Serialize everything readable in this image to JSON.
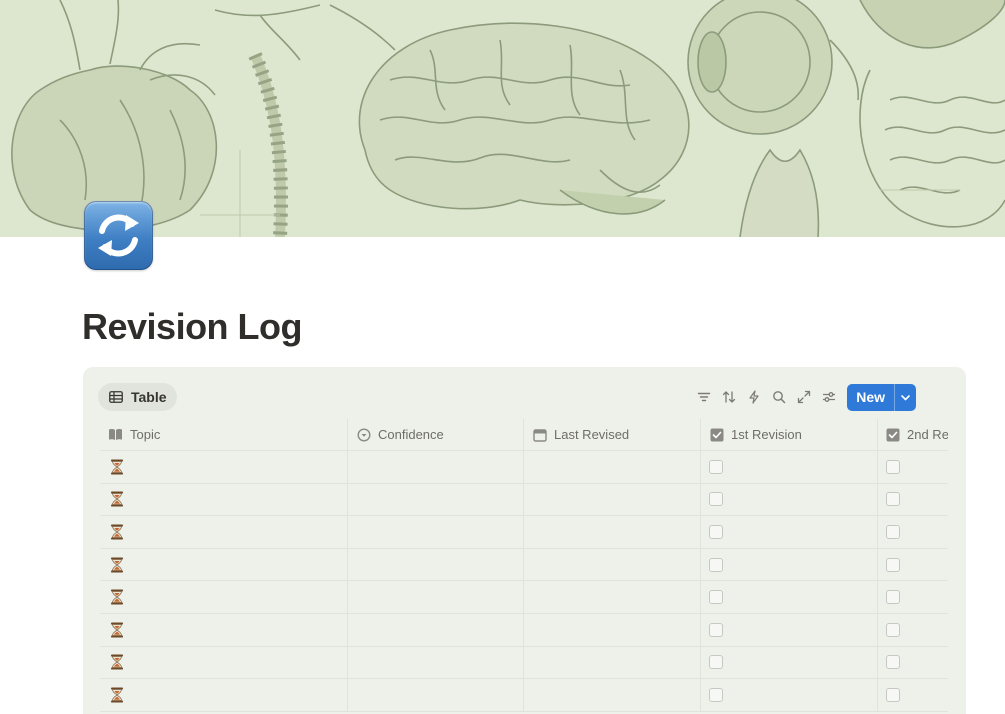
{
  "page": {
    "title": "Revision Log",
    "icon": "arrows-counterclockwise-emoji-icon"
  },
  "cover": {
    "description_icon": "anatomy-illustration-cover",
    "tint": "#dfe8d2"
  },
  "database": {
    "view_tab_label": "Table",
    "view_tab_icon": "table-icon",
    "toolbar": {
      "icons": [
        "filter-icon",
        "sort-icon",
        "automation-icon",
        "search-icon",
        "expand-icon",
        "settings-icon"
      ],
      "new_label": "New"
    },
    "columns": [
      {
        "label": "Topic",
        "icon": "book-icon"
      },
      {
        "label": "Confidence",
        "icon": "status-icon"
      },
      {
        "label": "Last Revised",
        "icon": "calendar-icon"
      },
      {
        "label": "1st Revision",
        "icon": "checkbox-icon"
      },
      {
        "label": "2nd Re",
        "icon": "checkbox-icon"
      }
    ],
    "rows": [
      {
        "topic_icon": "hourglass-icon",
        "confidence": "",
        "last_revised": "",
        "rev1": false,
        "rev2": false
      },
      {
        "topic_icon": "hourglass-icon",
        "confidence": "",
        "last_revised": "",
        "rev1": false,
        "rev2": false
      },
      {
        "topic_icon": "hourglass-icon",
        "confidence": "",
        "last_revised": "",
        "rev1": false,
        "rev2": false
      },
      {
        "topic_icon": "hourglass-icon",
        "confidence": "",
        "last_revised": "",
        "rev1": false,
        "rev2": false
      },
      {
        "topic_icon": "hourglass-icon",
        "confidence": "",
        "last_revised": "",
        "rev1": false,
        "rev2": false
      },
      {
        "topic_icon": "hourglass-icon",
        "confidence": "",
        "last_revised": "",
        "rev1": false,
        "rev2": false
      },
      {
        "topic_icon": "hourglass-icon",
        "confidence": "",
        "last_revised": "",
        "rev1": false,
        "rev2": false
      },
      {
        "topic_icon": "hourglass-icon",
        "confidence": "",
        "last_revised": "",
        "rev1": false,
        "rev2": false
      }
    ]
  },
  "colors": {
    "panel_bg": "#eef1ea",
    "accent_blue": "#2f7ad9",
    "title_text": "#2f2e2b"
  }
}
